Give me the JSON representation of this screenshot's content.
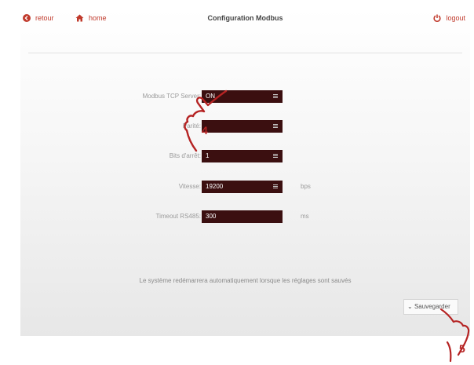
{
  "header": {
    "back_label": "retour",
    "home_label": "home",
    "title": "Configuration Modbus",
    "logout_label": "logout"
  },
  "form": {
    "tcp_label": "Modbus TCP Server:",
    "tcp_value": "ON",
    "parity_label": "Parité:",
    "parity_value": "",
    "stopbits_label": "Bits d'arrêt:",
    "stopbits_value": "1",
    "speed_label": "Vitesse:",
    "speed_value": "19200",
    "speed_unit": "bps",
    "timeout_label": "Timeout RS485:",
    "timeout_value": "300",
    "timeout_unit": "ms"
  },
  "notice": "Le système redémarrera automatiquement lorsque les réglages sont sauvés",
  "save_label": "Sauvegarder",
  "callouts": [
    "4",
    "5"
  ],
  "colors": {
    "accent": "#c0392b",
    "field_bg": "#3b0f10",
    "callout": "#b52323"
  }
}
